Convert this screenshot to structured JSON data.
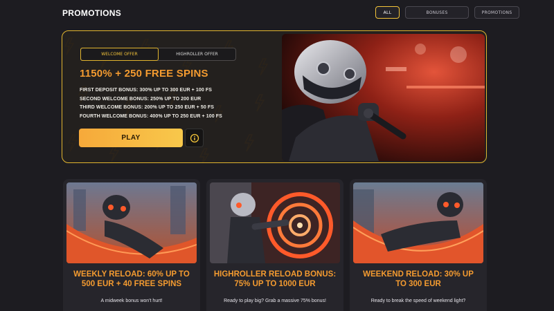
{
  "header": {
    "title": "PROMOTIONS",
    "filters": [
      {
        "label": "ALL",
        "active": true
      },
      {
        "label": "BONUSES",
        "active": false
      },
      {
        "label": "PROMOTIONS",
        "active": false
      }
    ]
  },
  "hero": {
    "tabs": [
      {
        "label": "WELCOME OFFER",
        "active": true
      },
      {
        "label": "HIGHROLLER OFFER",
        "active": false
      }
    ],
    "title": "1150% + 250 FREE SPINS",
    "bonuses": [
      "FIRST DEPOSIT BONUS: 300% UP TO 300 EUR + 100 FS",
      "SECOND WELCOME BONUS: 250% UP TO 200 EUR",
      "THIRD WELCOME BONUS: 200% UP TO 250 EUR + 50 FS",
      "FOURTH WELCOME BONUS: 400% UP TO 250 EUR + 100 FS"
    ],
    "play_label": "PLAY",
    "info_icon": "info-icon",
    "image": "robot-with-microphone-image"
  },
  "cards": [
    {
      "title": "WEEKLY RELOAD: 60% UP TO 500 EUR + 40 FREE SPINS",
      "description": "A midweek bonus won't hurt!",
      "image": "robot-in-hammock-image"
    },
    {
      "title": "HIGHROLLER RELOAD BONUS: 75% UP TO 1000 EUR",
      "description": "Ready to play big? Grab a massive 75% bonus!",
      "image": "robot-at-neon-ring-image"
    },
    {
      "title": "WEEKEND RELOAD: 30% UP TO 300 EUR",
      "description": "Ready to break the speed of weekend light?",
      "image": "robot-relaxing-image"
    }
  ],
  "colors": {
    "accent": "#f5c53a",
    "title_orange": "#f49b30",
    "background": "#1d1c21"
  }
}
